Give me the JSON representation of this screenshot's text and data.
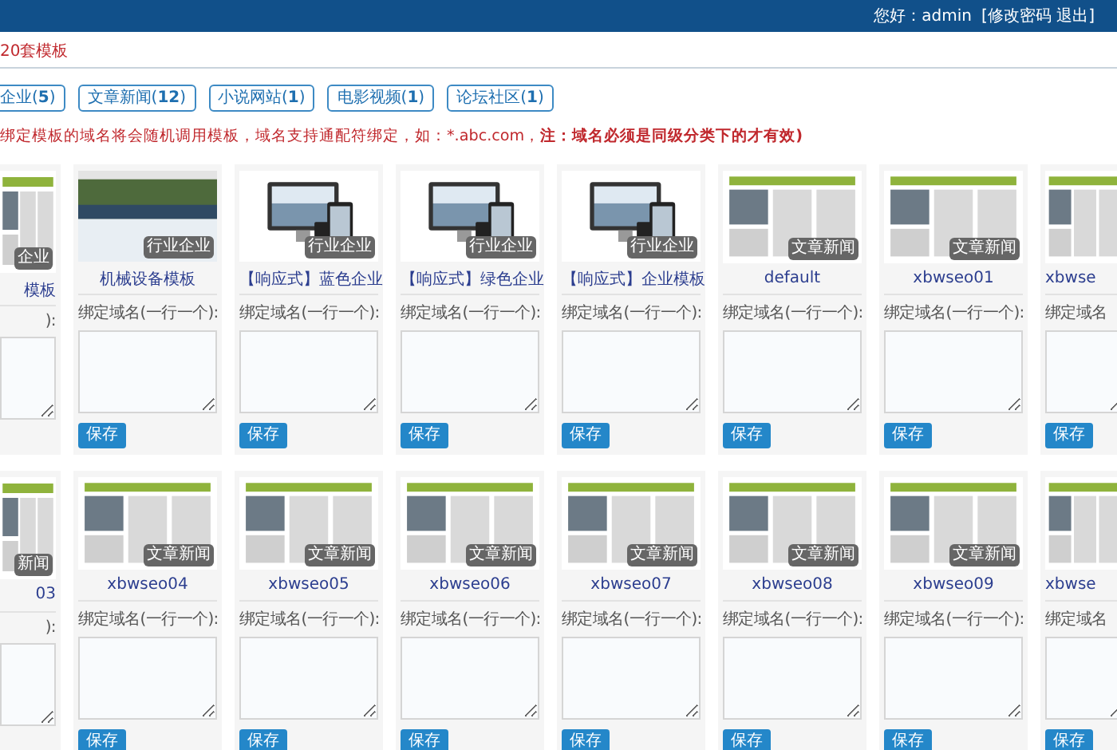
{
  "header": {
    "greeting": "您好：admin",
    "account_links": "[修改密码 退出]"
  },
  "template_count": "20套模板",
  "filters": [
    {
      "label": "企业(**5**)"
    },
    {
      "label": "文章新闻(**12**)"
    },
    {
      "label": "小说网站(**1**)"
    },
    {
      "label": "电影视频(**1**)"
    },
    {
      "label": "论坛社区(**1**)"
    }
  ],
  "notice": {
    "text": "绑定模板的域名将会随机调用模板，域名支持通配符绑定，如：*.abc.com，",
    "emphasis": "注：域名必须是同级分类下的才有效)"
  },
  "rows": [
    {
      "cards": [
        {
          "kind": "cut_left",
          "thumbnail": {
            "kind": "page"
          },
          "badge": "企业",
          "name": "模板",
          "label": "):"
        },
        {
          "kind": "full",
          "thumbnail": {
            "kind": "banner"
          },
          "badge": "行业企业",
          "name": "机械设备模板",
          "label": "绑定域名(一行一个):",
          "button": "保存"
        },
        {
          "kind": "full",
          "thumbnail": {
            "kind": "devices"
          },
          "badge": "行业企业",
          "name": "【响应式】蓝色企业",
          "label": "绑定域名(一行一个):",
          "button": "保存"
        },
        {
          "kind": "full",
          "thumbnail": {
            "kind": "devices"
          },
          "badge": "行业企业",
          "name": "【响应式】绿色企业",
          "label": "绑定域名(一行一个):",
          "button": "保存"
        },
        {
          "kind": "full",
          "thumbnail": {
            "kind": "devices"
          },
          "badge": "行业企业",
          "name": "【响应式】企业模板",
          "label": "绑定域名(一行一个):",
          "button": "保存"
        },
        {
          "kind": "full",
          "thumbnail": {
            "kind": "page"
          },
          "badge": "文章新闻",
          "name": "default",
          "label": "绑定域名(一行一个):",
          "button": "保存"
        },
        {
          "kind": "full",
          "thumbnail": {
            "kind": "page"
          },
          "badge": "文章新闻",
          "name": "xbwseo01",
          "label": "绑定域名(一行一个):",
          "button": "保存"
        },
        {
          "kind": "cut_right",
          "thumbnail": {
            "kind": "page"
          },
          "name": "xbwse",
          "label": "绑定域名",
          "button": "保存"
        }
      ]
    },
    {
      "cards": [
        {
          "kind": "cut_left",
          "thumbnail": {
            "kind": "page"
          },
          "badge": "新闻",
          "name": "03",
          "label": "):"
        },
        {
          "kind": "full",
          "thumbnail": {
            "kind": "page"
          },
          "badge": "文章新闻",
          "name": "xbwseo04",
          "label": "绑定域名(一行一个):",
          "button": "保存"
        },
        {
          "kind": "full",
          "thumbnail": {
            "kind": "page"
          },
          "badge": "文章新闻",
          "name": "xbwseo05",
          "label": "绑定域名(一行一个):",
          "button": "保存"
        },
        {
          "kind": "full",
          "thumbnail": {
            "kind": "page"
          },
          "badge": "文章新闻",
          "name": "xbwseo06",
          "label": "绑定域名(一行一个):",
          "button": "保存"
        },
        {
          "kind": "full",
          "thumbnail": {
            "kind": "page"
          },
          "badge": "文章新闻",
          "name": "xbwseo07",
          "label": "绑定域名(一行一个):",
          "button": "保存"
        },
        {
          "kind": "full",
          "thumbnail": {
            "kind": "page"
          },
          "badge": "文章新闻",
          "name": "xbwseo08",
          "label": "绑定域名(一行一个):",
          "button": "保存"
        },
        {
          "kind": "full",
          "thumbnail": {
            "kind": "page"
          },
          "badge": "文章新闻",
          "name": "xbwseo09",
          "label": "绑定域名(一行一个):",
          "button": "保存"
        },
        {
          "kind": "cut_right",
          "thumbnail": {
            "kind": "page"
          },
          "name": "xbwse",
          "label": "绑定域名",
          "button": "保存"
        }
      ]
    }
  ]
}
